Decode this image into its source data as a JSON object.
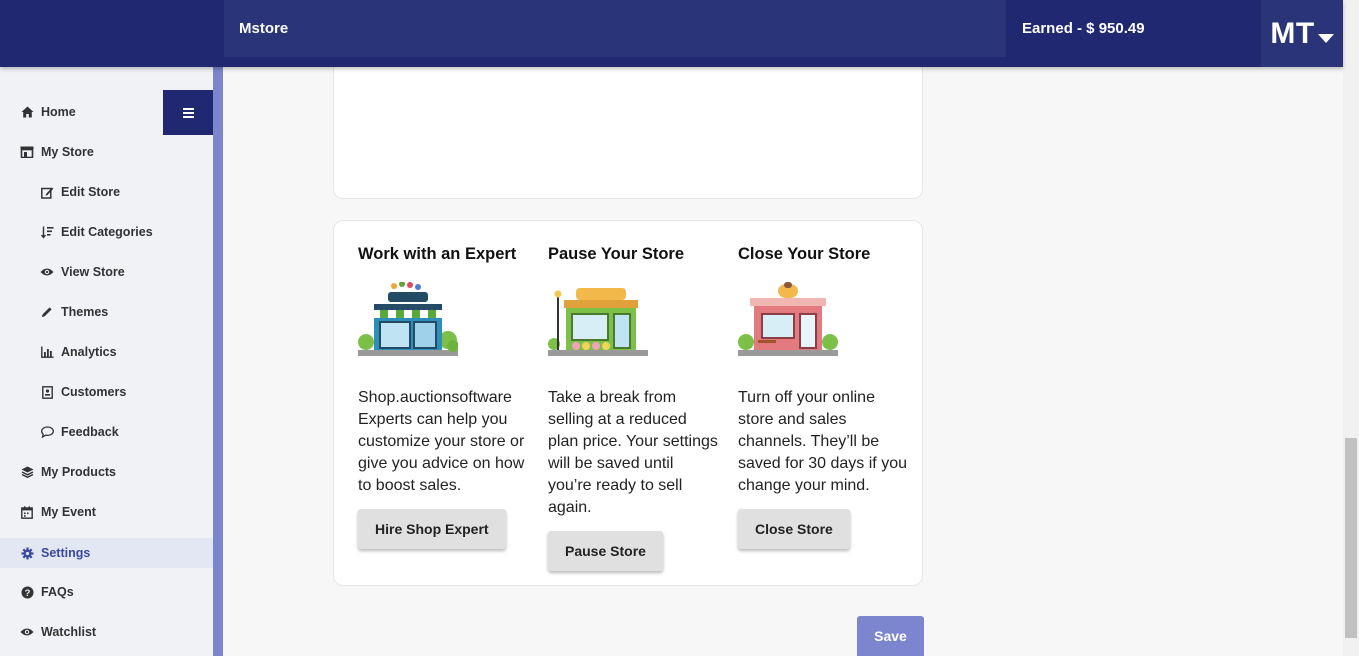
{
  "header": {
    "brand": "Mstore",
    "earned": "Earned - $ 950.49",
    "avatar_initials": "MT",
    "bar_color": "#1f2870"
  },
  "sidebar": {
    "items": [
      {
        "label": "Home",
        "icon": "home-icon"
      },
      {
        "label": "My Store",
        "icon": "store-icon"
      },
      {
        "label": "Edit Store",
        "icon": "edit-icon"
      },
      {
        "label": "Edit Categories",
        "icon": "sort-icon"
      },
      {
        "label": "View Store",
        "icon": "eye-icon"
      },
      {
        "label": "Themes",
        "icon": "pencil-icon"
      },
      {
        "label": "Analytics",
        "icon": "chart-icon"
      },
      {
        "label": "Customers",
        "icon": "contact-icon"
      },
      {
        "label": "Feedback",
        "icon": "comment-icon"
      },
      {
        "label": "My Products",
        "icon": "layers-icon"
      },
      {
        "label": "My Event",
        "icon": "calendar-icon"
      },
      {
        "label": "Settings",
        "icon": "gear-icon",
        "active": true
      },
      {
        "label": "FAQs",
        "icon": "question-icon"
      },
      {
        "label": "Watchlist",
        "icon": "eye-icon"
      }
    ],
    "rail_color": "#7b86cf"
  },
  "store_options": [
    {
      "title": "Work with an Expert",
      "description": "Shop.auctionsoftware Experts can help you customize your store or give you advice on how to boost sales.",
      "button": "Hire Shop Expert",
      "illustration": "expert-shop-illustration"
    },
    {
      "title": "Pause Your Store",
      "description": "Take a break from selling at a reduced plan price. Your settings will be saved until you’re ready to sell again.",
      "button": "Pause Store",
      "illustration": "pause-shop-illustration"
    },
    {
      "title": "Close Your Store",
      "description": "Turn off your online store and sales channels. They’ll be saved for 30 days if you change your mind.",
      "button": "Close Store",
      "illustration": "close-shop-illustration"
    }
  ],
  "save_label": "Save",
  "accent_color": "#7c86cf"
}
